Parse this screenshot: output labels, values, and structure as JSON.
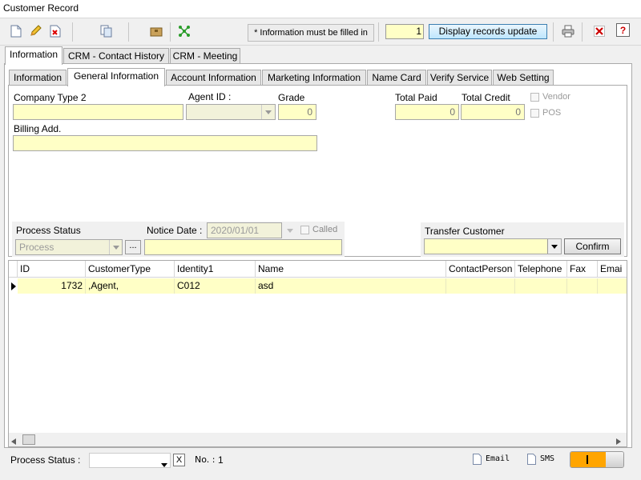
{
  "window": {
    "title": "Customer Record"
  },
  "toolbar": {
    "info_note": "* Information must be filled in",
    "record_count": "1",
    "display_button": "Display records update"
  },
  "main_tabs": [
    "Information",
    "CRM - Contact History",
    "CRM - Meeting"
  ],
  "sub_tabs": [
    "Information",
    "General Information",
    "Account Information",
    "Marketing Information",
    "Name Card",
    "Verify Service",
    "Web Setting"
  ],
  "form": {
    "company_type_label": "Company Type 2",
    "agent_id_label": "Agent ID :",
    "grade_label": "Grade",
    "grade_value": "0",
    "total_paid_label": "Total Paid",
    "total_paid_value": "0",
    "total_credit_label": "Total Credit",
    "total_credit_value": "0",
    "vendor_label": "Vendor",
    "pos_label": "POS",
    "billing_label": "Billing Add.",
    "process_status_label": "Process Status",
    "process_placeholder": "Process",
    "ellipsis": "...",
    "notice_date_label": "Notice Date :",
    "notice_date_value": "2020/01/01",
    "called_label": "Called",
    "transfer_label": "Transfer Customer",
    "confirm_button": "Confirm"
  },
  "grid": {
    "columns": [
      "ID",
      "CustomerType",
      "Identity1",
      "Name",
      "ContactPerson",
      "Telephone",
      "Fax",
      "Emai"
    ],
    "rows": [
      [
        "1732",
        ",Agent,",
        "C012",
        "asd",
        "",
        "",
        "",
        ""
      ]
    ]
  },
  "statusbar": {
    "process_status_label": "Process Status :",
    "clear_label": "X",
    "no_label": "No. :",
    "no_value": "1",
    "email_label": "Email",
    "sms_label": "SMS"
  },
  "colors": {
    "field_bg": "#ffffc6",
    "toggle_on": "#ffa500",
    "accent": "#3c7fb1"
  }
}
